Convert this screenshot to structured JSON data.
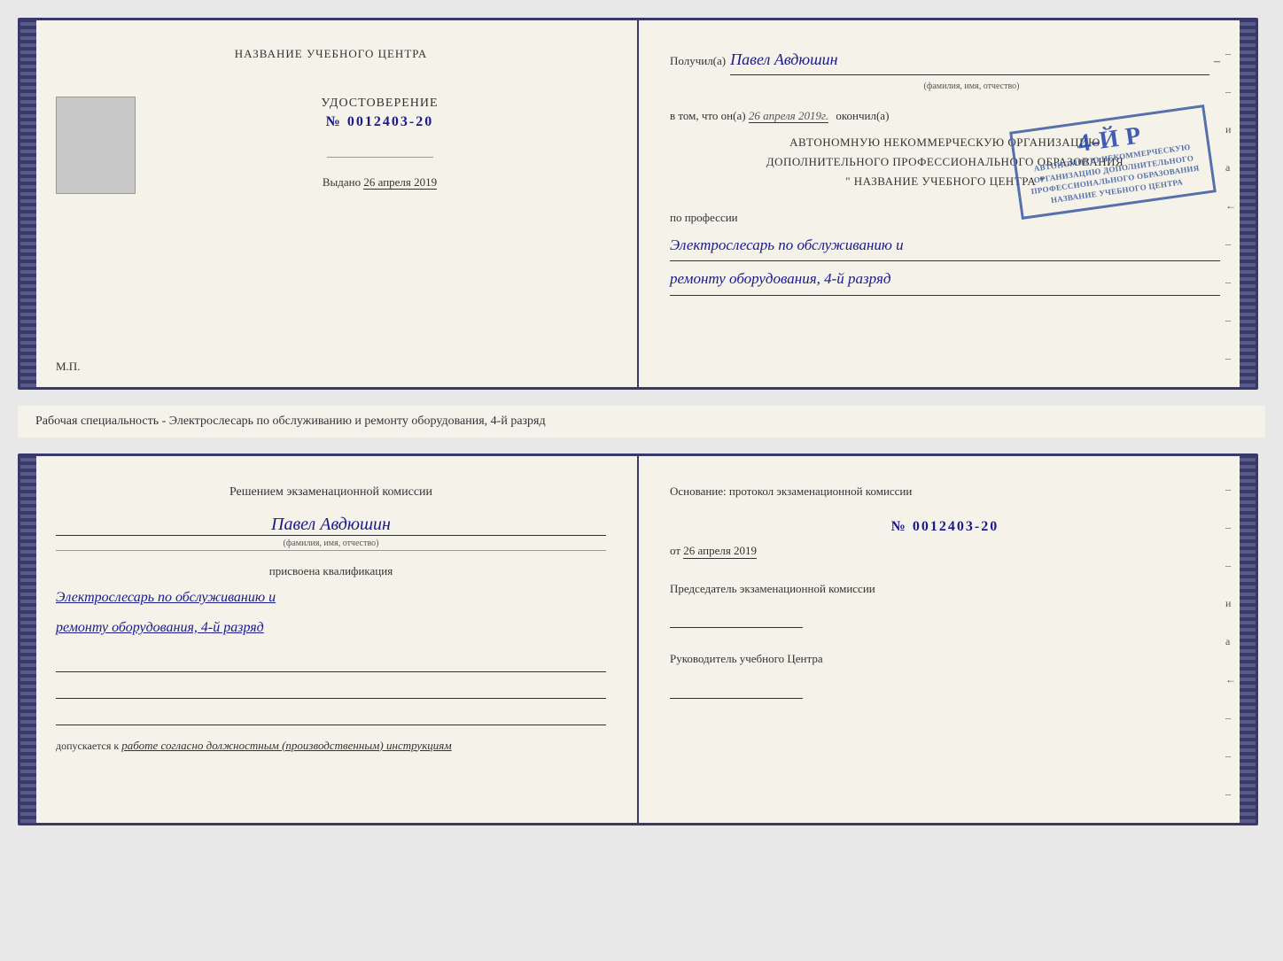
{
  "top_doc": {
    "left": {
      "title": "НАЗВАНИЕ УЧЕБНОГО ЦЕНТРА",
      "cert_label": "УДОСТОВЕРЕНИЕ",
      "cert_number": "№ 0012403-20",
      "issued_label": "Выдано",
      "issued_date": "26 апреля 2019",
      "mp_label": "М.П."
    },
    "right": {
      "received_label": "Получил(а)",
      "recipient_name": "Павел Авдюшин",
      "fio_label": "(фамилия, имя, отчество)",
      "v_tom_label": "в том, что он(а)",
      "date_value": "26 апреля 2019г.",
      "okончил_label": "окончил(а)",
      "org_line1": "АВТОНОМНУЮ НЕКОММЕРЧЕСКУЮ ОРГАНИЗАЦИЮ",
      "org_line2": "ДОПОЛНИТЕЛЬНОГО ПРОФЕССИОНАЛЬНОГО ОБРАЗОВАНИЯ",
      "org_line3": "\" НАЗВАНИЕ УЧЕБНОГО ЦЕНТРА \"",
      "profession_label": "по профессии",
      "profession_line1": "Электрослесарь по обслуживанию и",
      "profession_line2": "ремонту оборудования, 4-й разряд"
    }
  },
  "middle_text": "Рабочая специальность - Электрослесарь по обслуживанию и ремонту оборудования, 4-й разряд",
  "bottom_doc": {
    "left": {
      "title_line1": "Решением экзаменационной  комиссии",
      "person_name": "Павел Авдюшин",
      "fio_label": "(фамилия, имя, отчество)",
      "qual_label": "присвоена квалификация",
      "qual_line1": "Электрослесарь по обслуживанию и",
      "qual_line2": "ремонту оборудования, 4-й разряд",
      "допускается_label": "допускается к",
      "допускается_value": "работе согласно должностным (производственным) инструкциям"
    },
    "right": {
      "osnov_label": "Основание: протокол экзаменационной  комиссии",
      "protocol_number": "№  0012403-20",
      "ot_label": "от",
      "ot_date": "26 апреля 2019",
      "predsedatel_label": "Председатель экзаменационной комиссии",
      "rukovod_label": "Руководитель учебного Центра"
    }
  },
  "stamp": {
    "big_text": "4-й р",
    "small_text_line1": "АВТОНОМНОМУ НЕКОММЕРЧЕСКУЮ ОРГАНИЗАЦИЮ",
    "small_text_line2": "ДОПОЛНИТЕЛЬНОГО ПРОФЕССИОНАЛЬНОГО ОБРАЗОВАНИЯ",
    "small_text_line3": "НАЗВАНИЕ УЧЕБНОГО ЦЕНТРА"
  },
  "right_markers": [
    "и",
    "а",
    "←",
    "–",
    "–",
    "–",
    "–",
    "–"
  ]
}
